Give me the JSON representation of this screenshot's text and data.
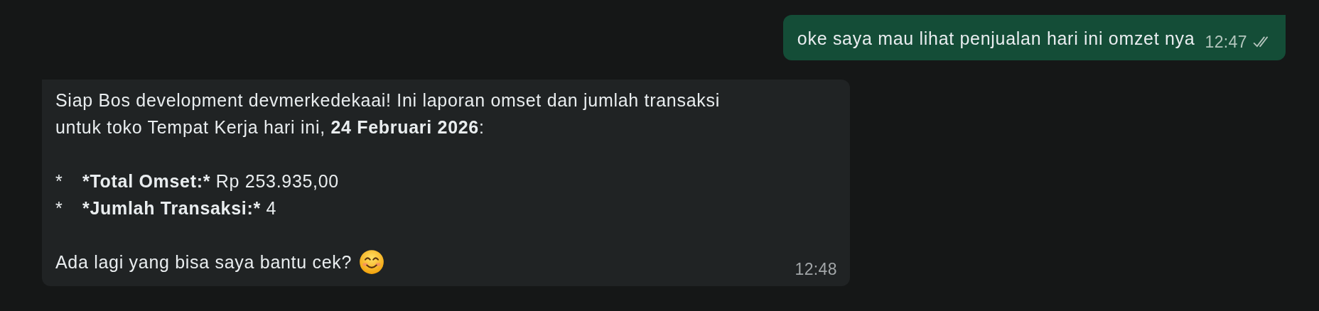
{
  "messages": [
    {
      "outgoing": true,
      "time": "12:47",
      "delivered": true,
      "blocks": [
        {
          "kind": "paragraph",
          "text": "oke saya mau lihat penjualan hari ini omzet nya"
        }
      ]
    },
    {
      "outgoing": false,
      "time": "12:48",
      "blocks": [
        {
          "kind": "paragraph",
          "text": "Siap Bos development devmerkedekaai! Ini laporan omset dan jumlah transaksi\nuntuk toko Tempat Kerja hari ini, **24 Februari 2026**:"
        },
        {
          "kind": "bullet",
          "marker": "*",
          "label": "*Total Omset:*",
          "value": "Rp 253.935,00"
        },
        {
          "kind": "bullet",
          "marker": "*",
          "label": "*Jumlah Transaksi:*",
          "value": "4"
        },
        {
          "kind": "paragraph",
          "text": "Ada lagi yang bisa saya bantu cek?",
          "emoji": true
        }
      ]
    }
  ]
}
